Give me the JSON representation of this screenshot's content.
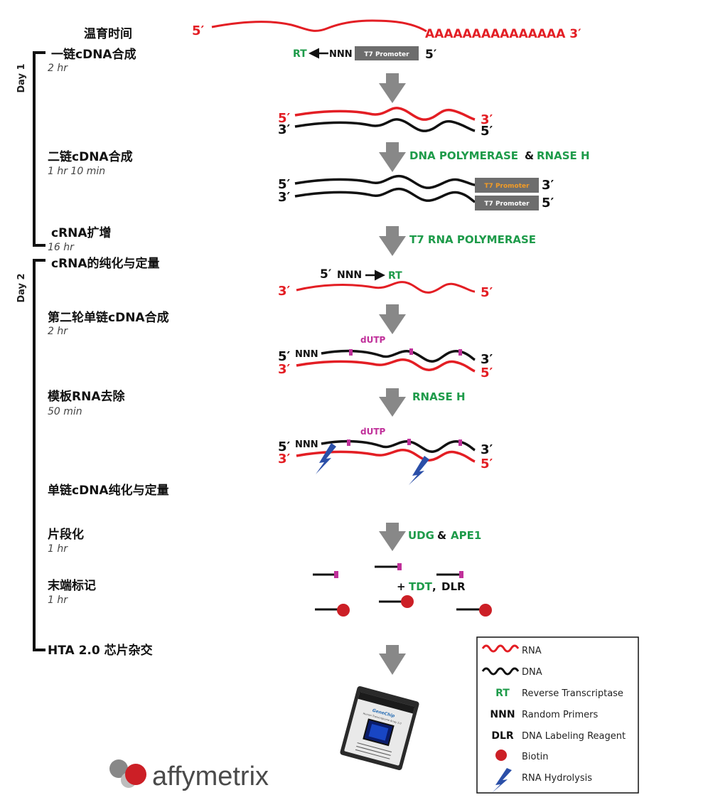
{
  "colors": {
    "rna": "#e31e24",
    "dna": "#111111",
    "enzyme": "#1e9b4a",
    "dutp": "#c0309a",
    "arrow": "#888888",
    "promoter_box": "#6d6d6d",
    "promoter_text_orange": "#f39c26",
    "hydrolysis": "#2b4fa8",
    "biotin": "#cc1f26"
  },
  "timeline": {
    "day1_label": "Day 1",
    "day2_label": "Day 2",
    "incubation_header": "温育时间",
    "steps": [
      {
        "name": "一链cDNA合成",
        "time": "2 hr"
      },
      {
        "name": "二链cDNA合成",
        "time": "1 hr 10 min"
      },
      {
        "name": "cRNA扩增",
        "time": "16 hr"
      },
      {
        "name": "cRNA的纯化与定量",
        "time": ""
      },
      {
        "name": "第二轮单链cDNA合成",
        "time": "2 hr"
      },
      {
        "name": "模板RNA去除",
        "time": "50 min"
      },
      {
        "name": "单链cDNA纯化与定量",
        "time": ""
      },
      {
        "name": "片段化",
        "time": "1 hr"
      },
      {
        "name": "末端标记",
        "time": "1 hr"
      },
      {
        "name": "HTA 2.0 芯片杂交",
        "time": ""
      }
    ]
  },
  "diagram": {
    "mrna_5": "5′",
    "polya": "AAAAAAAAAAAAAAA 3′",
    "rt": "RT",
    "nnn": "NNN",
    "t7_promoter": "T7 Promoter",
    "five_prime": "5′",
    "three_prime": "3′",
    "step2_enzyme_a": "DNA POLYMERASE",
    "amp": "&",
    "step2_enzyme_b": "RNASE H",
    "step3_enzyme": "T7 RNA POLYMERASE",
    "dutp": "dUTP",
    "step5_enzyme": "RNASE H",
    "frag_enzyme_a": "UDG",
    "frag_enzyme_b": "APE1",
    "label_plus": "+ ",
    "label_tdt": "TDT",
    "label_comma": ", ",
    "label_dlr": "DLR"
  },
  "chip": {
    "brand": "GeneChip",
    "line1": "Human Transcriptome Array 2.0"
  },
  "legend": {
    "items": [
      {
        "key": "",
        "text": "RNA"
      },
      {
        "key": "",
        "text": "DNA"
      },
      {
        "key": "RT",
        "text": "Reverse Transcriptase"
      },
      {
        "key": "NNN",
        "text": "Random Primers"
      },
      {
        "key": "DLR",
        "text": "DNA Labeling Reagent"
      },
      {
        "key": "",
        "text": "Biotin"
      },
      {
        "key": "",
        "text": "RNA Hydrolysis"
      }
    ]
  },
  "logo": {
    "text": "affymetrix"
  }
}
